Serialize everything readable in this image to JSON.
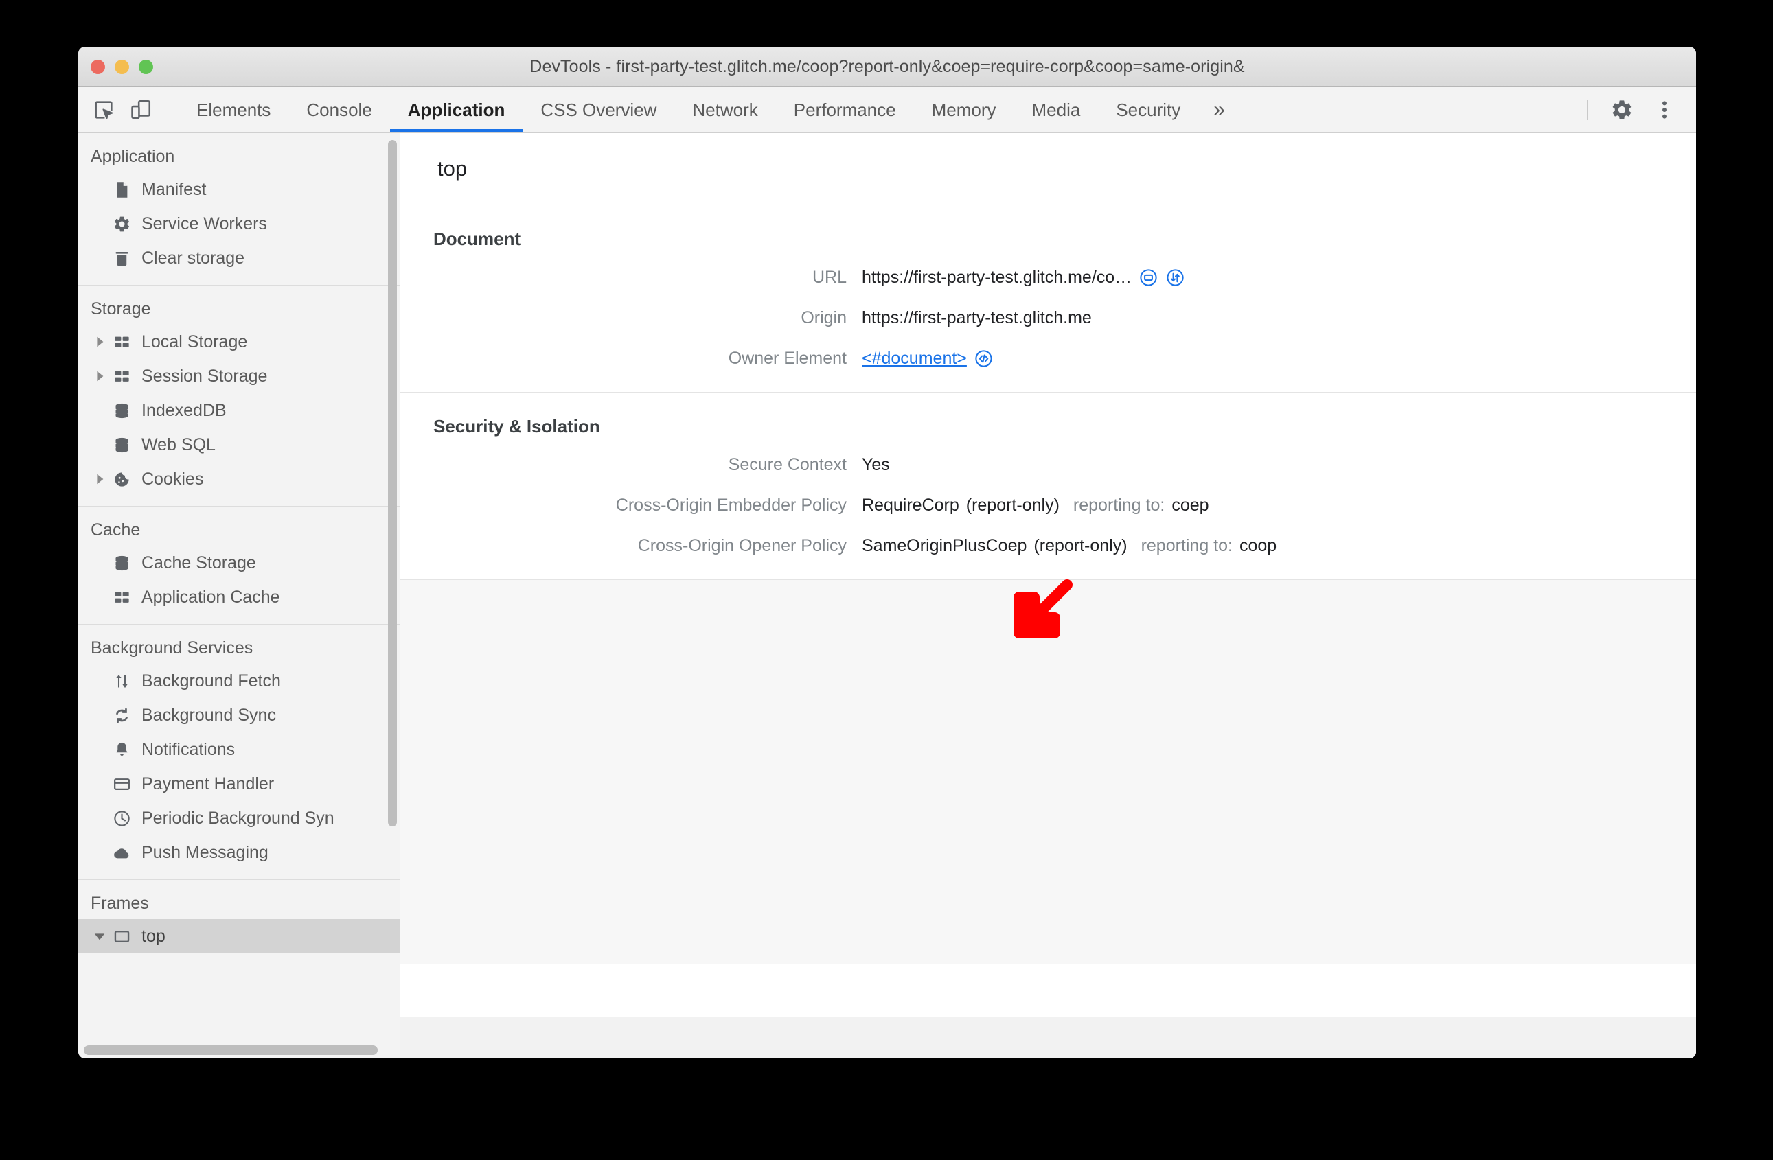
{
  "window": {
    "title": "DevTools - first-party-test.glitch.me/coop?report-only&coep=require-corp&coop=same-origin&",
    "traffic_lights": [
      "close",
      "minimize",
      "zoom"
    ]
  },
  "toolbar": {
    "inspect_icon": "inspect-element-icon",
    "device_icon": "device-toolbar-icon",
    "settings_icon": "gear-icon",
    "more_icon": "more-vertical-icon",
    "more_tabs_label": "»",
    "tabs": [
      {
        "label": "Elements",
        "active": false
      },
      {
        "label": "Console",
        "active": false
      },
      {
        "label": "Application",
        "active": true
      },
      {
        "label": "CSS Overview",
        "active": false
      },
      {
        "label": "Network",
        "active": false
      },
      {
        "label": "Performance",
        "active": false
      },
      {
        "label": "Memory",
        "active": false
      },
      {
        "label": "Media",
        "active": false
      },
      {
        "label": "Security",
        "active": false
      }
    ]
  },
  "sidebar": {
    "sections": [
      {
        "title": "Application",
        "items": [
          {
            "label": "Manifest",
            "icon": "manifest-file-icon",
            "twisty": false,
            "selected": false
          },
          {
            "label": "Service Workers",
            "icon": "gear-icon",
            "twisty": false,
            "selected": false
          },
          {
            "label": "Clear storage",
            "icon": "trash-icon",
            "twisty": false,
            "selected": false
          }
        ]
      },
      {
        "title": "Storage",
        "items": [
          {
            "label": "Local Storage",
            "icon": "table-icon",
            "twisty": true,
            "selected": false
          },
          {
            "label": "Session Storage",
            "icon": "table-icon",
            "twisty": true,
            "selected": false
          },
          {
            "label": "IndexedDB",
            "icon": "database-icon",
            "twisty": false,
            "selected": false
          },
          {
            "label": "Web SQL",
            "icon": "database-icon",
            "twisty": false,
            "selected": false
          },
          {
            "label": "Cookies",
            "icon": "cookie-icon",
            "twisty": true,
            "selected": false
          }
        ]
      },
      {
        "title": "Cache",
        "items": [
          {
            "label": "Cache Storage",
            "icon": "database-icon",
            "twisty": false,
            "selected": false
          },
          {
            "label": "Application Cache",
            "icon": "table-icon",
            "twisty": false,
            "selected": false
          }
        ]
      },
      {
        "title": "Background Services",
        "items": [
          {
            "label": "Background Fetch",
            "icon": "updown-arrows-icon",
            "twisty": false,
            "selected": false
          },
          {
            "label": "Background Sync",
            "icon": "sync-icon",
            "twisty": false,
            "selected": false
          },
          {
            "label": "Notifications",
            "icon": "bell-icon",
            "twisty": false,
            "selected": false
          },
          {
            "label": "Payment Handler",
            "icon": "credit-card-icon",
            "twisty": false,
            "selected": false
          },
          {
            "label": "Periodic Background Syn",
            "icon": "clock-icon",
            "twisty": false,
            "selected": false
          },
          {
            "label": "Push Messaging",
            "icon": "cloud-icon",
            "twisty": false,
            "selected": false
          }
        ]
      },
      {
        "title": "Frames",
        "items": [
          {
            "label": "top",
            "icon": "frame-icon",
            "twisty": true,
            "twisty_expanded": true,
            "selected": true
          }
        ]
      }
    ]
  },
  "main": {
    "frame_title": "top",
    "sections": [
      {
        "heading": "Document",
        "rows": [
          {
            "label": "URL",
            "value": "https://first-party-test.glitch.me/co…",
            "icons": [
              "open-in-new-tab-icon",
              "network-panel-icon"
            ],
            "link": false
          },
          {
            "label": "Origin",
            "value": "https://first-party-test.glitch.me",
            "icons": [],
            "link": false
          },
          {
            "label": "Owner Element",
            "value": "<#document>",
            "icons": [
              "reveal-in-elements-icon"
            ],
            "link": true
          }
        ]
      },
      {
        "heading": "Security & Isolation",
        "rows": [
          {
            "label": "Secure Context",
            "value": "Yes",
            "icons": [],
            "link": false
          },
          {
            "label": "Cross-Origin Embedder Policy",
            "value": "RequireCorp",
            "note": "(report-only)",
            "reporting_prefix": "reporting to: ",
            "reporting_endpoint": "coep",
            "icons": [],
            "link": false
          },
          {
            "label": "Cross-Origin Opener Policy",
            "value": "SameOriginPlusCoep",
            "note": "(report-only)",
            "reporting_prefix": "reporting to: ",
            "reporting_endpoint": "coop",
            "icons": [],
            "link": false
          }
        ]
      }
    ]
  },
  "annotation": {
    "arrow": "red-down-left-arrow",
    "color": "#FF0000"
  },
  "colors": {
    "accent": "#1a73e8",
    "link": "#1a73e8",
    "label_gray": "#80868b",
    "text": "#202124",
    "annotation_red": "#FF0000",
    "selected_row": "#d3d3d3"
  }
}
